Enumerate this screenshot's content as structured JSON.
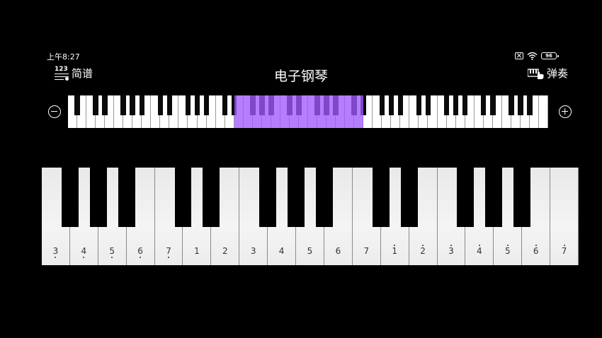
{
  "status_bar": {
    "time": "上午8:27",
    "battery": "96"
  },
  "toolbar": {
    "notation_icon_text": "123",
    "notation_label": "简谱",
    "title": "电子钢琴",
    "play_label": "弹奏"
  },
  "mini_keyboard": {
    "white_keys": 52,
    "highlight_start_white": 18,
    "highlight_white_count": 14
  },
  "keyboard": {
    "white_keys": [
      {
        "n": "3",
        "oct": "low"
      },
      {
        "n": "4",
        "oct": "low"
      },
      {
        "n": "5",
        "oct": "low"
      },
      {
        "n": "6",
        "oct": "low"
      },
      {
        "n": "7",
        "oct": "low"
      },
      {
        "n": "1",
        "oct": "mid"
      },
      {
        "n": "2",
        "oct": "mid"
      },
      {
        "n": "3",
        "oct": "mid"
      },
      {
        "n": "4",
        "oct": "mid"
      },
      {
        "n": "5",
        "oct": "mid"
      },
      {
        "n": "6",
        "oct": "mid"
      },
      {
        "n": "7",
        "oct": "mid"
      },
      {
        "n": "1",
        "oct": "high"
      },
      {
        "n": "2",
        "oct": "high"
      },
      {
        "n": "3",
        "oct": "high"
      },
      {
        "n": "4",
        "oct": "high"
      },
      {
        "n": "5",
        "oct": "high"
      },
      {
        "n": "6",
        "oct": "high"
      },
      {
        "n": "7",
        "oct": "high"
      }
    ],
    "black_after_white": [
      1,
      2,
      3,
      5,
      6,
      8,
      9,
      10,
      12,
      13,
      15,
      16,
      17
    ]
  },
  "colors": {
    "background": "#000000",
    "highlight": "#a05aff"
  }
}
